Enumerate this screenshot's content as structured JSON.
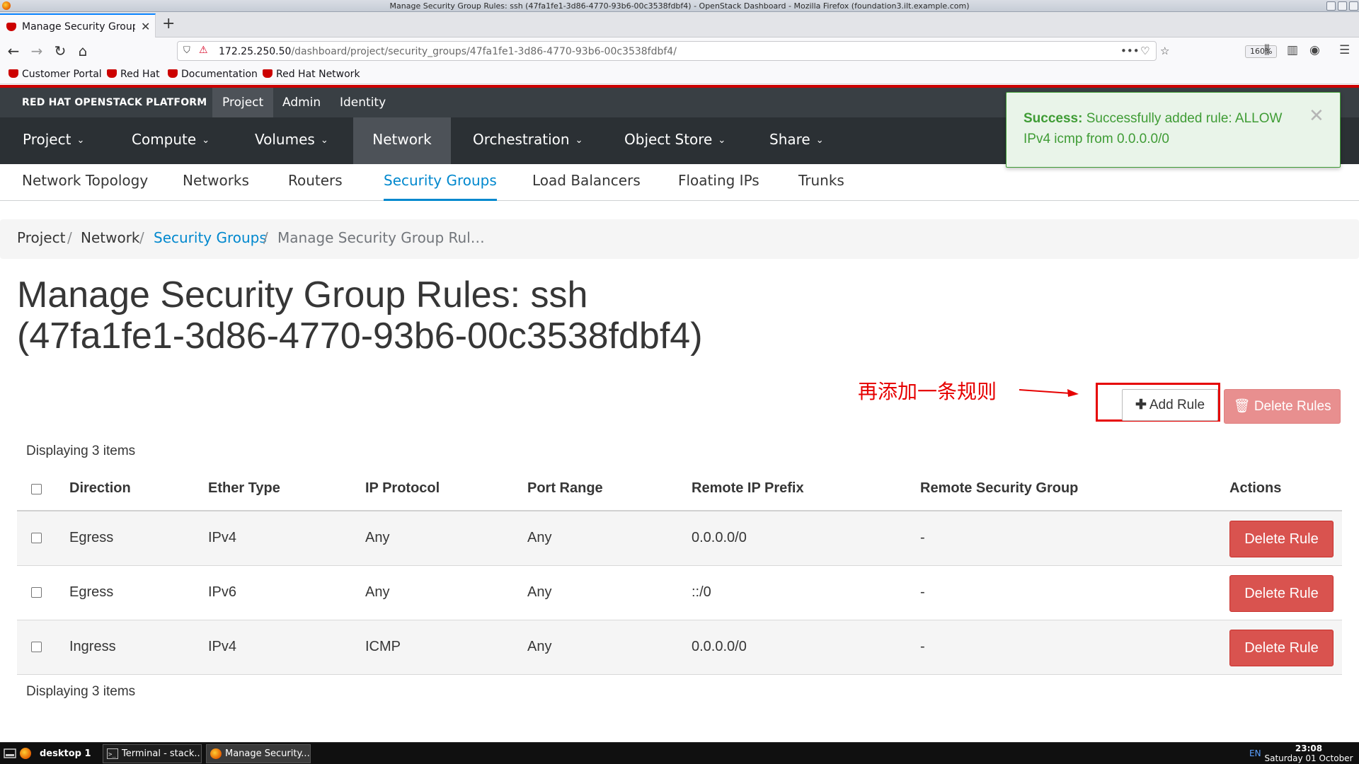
{
  "window": {
    "title": "Manage Security Group Rules: ssh (47fa1fe1-3d86-4770-93b6-00c3538fdbf4) - OpenStack Dashboard - Mozilla Firefox (foundation3.ilt.example.com)"
  },
  "browser": {
    "tab_title": "Manage Security Group Rules: ssh",
    "url_host": "172.25.250.50",
    "url_path": "/dashboard/project/security_groups/47fa1fe1-3d86-4770-93b6-00c3538fdbf4/",
    "zoom": "160%",
    "bookmarks": [
      "Customer Portal",
      "Red Hat",
      "Documentation",
      "Red Hat Network"
    ]
  },
  "openstack": {
    "brand": "RED HAT OPENSTACK PLATFORM",
    "context_tabs": [
      "Project",
      "Admin",
      "Identity"
    ],
    "main_nav": [
      "Project",
      "Compute",
      "Volumes",
      "Network",
      "Orchestration",
      "Object Store",
      "Share"
    ],
    "sub_nav": [
      "Network Topology",
      "Networks",
      "Routers",
      "Security Groups",
      "Load Balancers",
      "Floating IPs",
      "Trunks"
    ],
    "breadcrumb": [
      "Project",
      "Network",
      "Security Groups",
      "Manage Security Group Rul…"
    ],
    "page_title_line1": "Manage Security Group Rules: ssh",
    "page_title_line2": "(47fa1fe1-3d86-4770-93b6-00c3538fdbf4)",
    "add_rule_label": "Add Rule",
    "delete_rules_label": "Delete Rules",
    "annotation": "再添加一条规则",
    "count_text": "Displaying 3 items",
    "table": {
      "headers": [
        "Direction",
        "Ether Type",
        "IP Protocol",
        "Port Range",
        "Remote IP Prefix",
        "Remote Security Group",
        "Actions"
      ],
      "rows": [
        {
          "direction": "Egress",
          "ether": "IPv4",
          "protocol": "Any",
          "port": "Any",
          "prefix": "0.0.0.0/0",
          "group": "-",
          "action": "Delete Rule"
        },
        {
          "direction": "Egress",
          "ether": "IPv6",
          "protocol": "Any",
          "port": "Any",
          "prefix": "::/0",
          "group": "-",
          "action": "Delete Rule"
        },
        {
          "direction": "Ingress",
          "ether": "IPv4",
          "protocol": "ICMP",
          "port": "Any",
          "prefix": "0.0.0.0/0",
          "group": "-",
          "action": "Delete Rule"
        }
      ]
    },
    "toast": {
      "strong": "Success:",
      "text": "Successfully added rule: ALLOW IPv4 icmp from 0.0.0.0/0"
    }
  },
  "taskbar": {
    "desktop": "desktop 1",
    "tasks": [
      "Terminal - stack...",
      "Manage Security..."
    ],
    "lang": "EN",
    "time": "23:08",
    "date": "Saturday 01 October"
  },
  "colors": {
    "brand_red": "#cc0000",
    "link_blue": "#0088ce",
    "danger": "#d9534f",
    "success": "#3f9c35",
    "annotation_red": "#e60000"
  }
}
